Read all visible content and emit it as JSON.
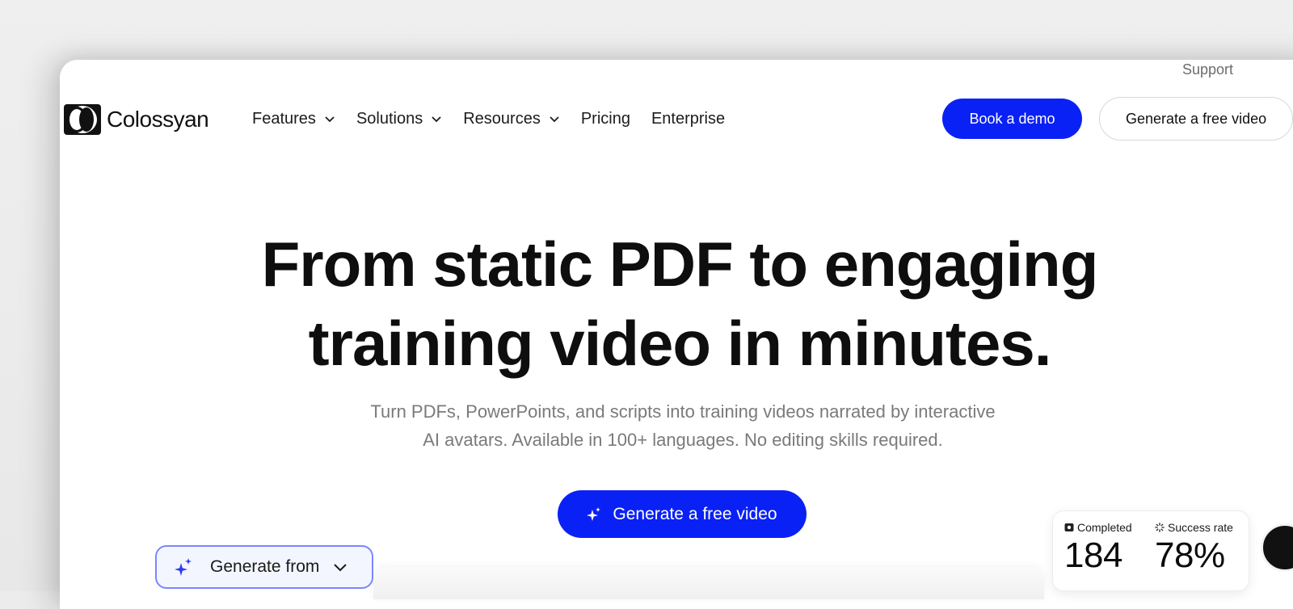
{
  "header": {
    "support_label": "Support",
    "logo_text": "Colossyan",
    "nav": [
      {
        "label": "Features",
        "has_dropdown": true
      },
      {
        "label": "Solutions",
        "has_dropdown": true
      },
      {
        "label": "Resources",
        "has_dropdown": true
      },
      {
        "label": "Pricing",
        "has_dropdown": false
      },
      {
        "label": "Enterprise",
        "has_dropdown": false
      }
    ],
    "book_demo_label": "Book a demo",
    "generate_free_label": "Generate a free video"
  },
  "hero": {
    "title_line1": "From static PDF to engaging",
    "title_line2": "training video in minutes.",
    "subtitle_line1": "Turn PDFs, PowerPoints, and scripts into training videos narrated by interactive",
    "subtitle_line2": "AI avatars. Available in 100+ languages. No editing skills required.",
    "cta_label": "Generate a free video",
    "cta_icon": "sparkle-icon"
  },
  "generate_from": {
    "label": "Generate from",
    "icon": "sparkle-icon"
  },
  "stats": {
    "completed_label": "Completed",
    "completed_value": "184",
    "success_label": "Success rate",
    "success_value": "78%"
  },
  "colors": {
    "brand_blue": "#0a21f5",
    "text_dark": "#0e0e0e",
    "text_muted": "#7a7a7a"
  }
}
